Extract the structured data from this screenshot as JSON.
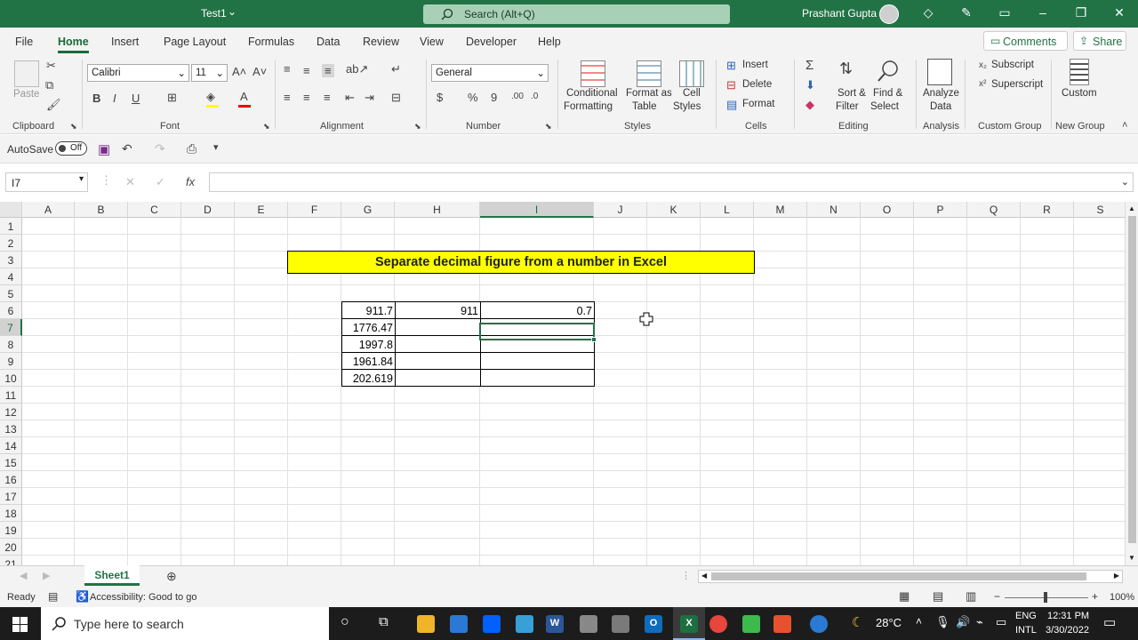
{
  "titlebar": {
    "doc_title": "Test1",
    "doc_title_caret": "⌄",
    "search": "Search (Alt+Q)",
    "user": "Prashant Gupta"
  },
  "tabs": [
    "File",
    "Home",
    "Insert",
    "Page Layout",
    "Formulas",
    "Data",
    "Review",
    "View",
    "Developer",
    "Help"
  ],
  "tab_buttons": {
    "comments": "Comments",
    "share": "Share"
  },
  "ribbon": {
    "clipboard": {
      "label": "Clipboard",
      "paste": "Paste"
    },
    "font": {
      "label": "Font",
      "name": "Calibri",
      "size": "11"
    },
    "alignment": {
      "label": "Alignment"
    },
    "number": {
      "label": "Number",
      "format": "General"
    },
    "styles": {
      "label": "Styles",
      "conditional1": "Conditional",
      "conditional2": "Formatting",
      "format_as1": "Format as",
      "format_as2": "Table",
      "cell1": "Cell",
      "cell2": "Styles"
    },
    "cells": {
      "label": "Cells",
      "insert": "Insert",
      "delete": "Delete",
      "format": "Format"
    },
    "editing": {
      "label": "Editing",
      "sort1": "Sort &",
      "sort2": "Filter",
      "find1": "Find &",
      "find2": "Select"
    },
    "analysis": {
      "label": "Analysis",
      "analyze1": "Analyze",
      "analyze2": "Data"
    },
    "custom_group": {
      "label": "Custom Group",
      "subscript": "Subscript",
      "superscript": "Superscript"
    },
    "new_group": {
      "label": "New Group",
      "custom": "Custom"
    }
  },
  "qat": {
    "autosave": "AutoSave",
    "toggle": "Off"
  },
  "formula_bar": {
    "name_box": "I7",
    "fx": "fx",
    "formula": ""
  },
  "columns": [
    "A",
    "B",
    "C",
    "D",
    "E",
    "F",
    "G",
    "H",
    "I",
    "J",
    "K",
    "L",
    "M",
    "N",
    "O",
    "P",
    "Q",
    "R",
    "S"
  ],
  "rows": [
    "1",
    "2",
    "3",
    "4",
    "5",
    "6",
    "7",
    "8",
    "9",
    "10",
    "11",
    "12",
    "13",
    "14",
    "15",
    "16",
    "17",
    "18",
    "19",
    "20",
    "21"
  ],
  "sheet": {
    "banner": "Separate decimal figure from a number in Excel",
    "g_values": [
      "911.7",
      "1776.47",
      "1997.8",
      "1961.84",
      "202.619"
    ],
    "h_values": [
      "911",
      "",
      "",
      "",
      ""
    ],
    "i_values": [
      "0.7",
      "",
      "",
      "",
      ""
    ]
  },
  "sheet_tabs": {
    "active": "Sheet1"
  },
  "status": {
    "ready": "Ready",
    "accessibility": "Accessibility: Good to go",
    "zoom": "100%"
  },
  "taskbar": {
    "search": "Type here to search",
    "temp": "28°C",
    "lang1": "ENG",
    "lang2": "INTL",
    "time": "12:31 PM",
    "date": "3/30/2022"
  }
}
